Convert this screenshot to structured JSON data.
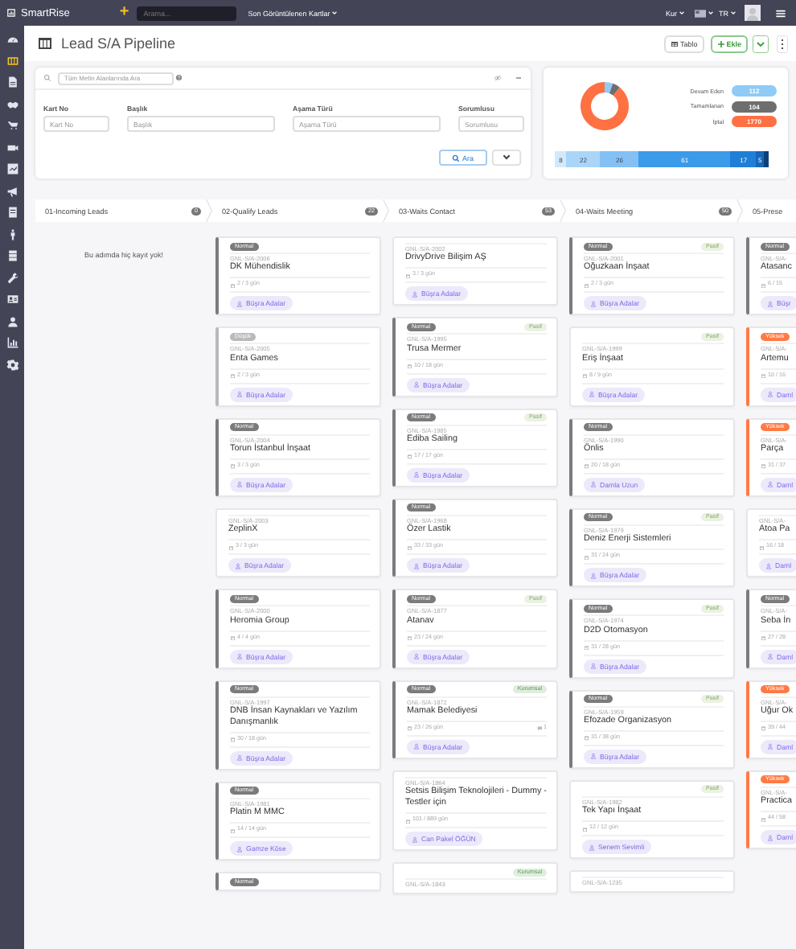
{
  "top_bar": {
    "logo": "SmartRise",
    "add": "+",
    "search": {
      "placeholder": "Arama..."
    },
    "recent": "Son Görüntülenen Kartlar",
    "currency": "Kur",
    "language": "TR"
  },
  "sidebar": {
    "items": [
      {
        "selected": false
      },
      {
        "selected": true
      },
      {
        "selected": false
      },
      {
        "selected": false
      },
      {
        "selected": false
      },
      {
        "selected": false
      },
      {
        "selected": false
      },
      {
        "selected": false
      },
      {
        "selected": false
      },
      {
        "selected": false
      },
      {
        "selected": false
      },
      {
        "selected": false
      },
      {
        "selected": false
      },
      {
        "selected": false
      },
      {
        "selected": false
      },
      {
        "selected": false
      }
    ]
  },
  "page": {
    "title": "Lead S/A Pipeline",
    "buttons": {
      "table": "Tablo",
      "add": "Ekle"
    }
  },
  "filter": {
    "search": {
      "placeholder": "Tüm Metin Alanlarında Ara"
    },
    "fields": [
      {
        "label": "Kart No",
        "placeholder": "Kart No"
      },
      {
        "label": "Başlık",
        "placeholder": "Başlık"
      },
      {
        "label": "Aşama Türü",
        "placeholder": "Aşama Türü"
      },
      {
        "label": "Sorumlusu",
        "placeholder": "Sorumlusu"
      }
    ],
    "search_button": "Ara"
  },
  "summary": {
    "chart_data": {
      "type": "donut",
      "categories": [
        "Devam Eden",
        "Tamamlanan",
        "İptal"
      ],
      "values": [
        5.6,
        5.2,
        89.2
      ]
    },
    "legend": [
      {
        "count": "112",
        "color": "#8ecbf6"
      },
      {
        "count": "104",
        "color": "#6e6e6e"
      },
      {
        "count": "1770",
        "color": "#ff7043"
      }
    ],
    "stage_bar": [
      {
        "label": "8",
        "color": "#d3e9fb"
      },
      {
        "label": "22",
        "color": "#aad5f8"
      },
      {
        "label": "26",
        "color": "#84c0f3"
      },
      {
        "label": "61",
        "color": "#3c9aea"
      },
      {
        "label": "17",
        "color": "#1f7fd6"
      },
      {
        "label": "5",
        "color": "#1766b9"
      },
      {
        "color": "#0d3f7a"
      }
    ]
  },
  "columns": [
    {
      "title": "01-Incoming Leads",
      "count": "0",
      "empty": "Bu adımda hiç kayıt yok!"
    },
    {
      "title": "02-Qualify Leads",
      "count": "22",
      "cards": [
        {
          "priority": {
            "text": "Normal",
            "kind": "normal"
          },
          "code": "GNL-S/A-2006",
          "title": "DK Mühendislik",
          "days": "2 / 3 gün",
          "owner": "Büşra Adalar"
        },
        {
          "priority": {
            "text": "Düşük",
            "kind": "low"
          },
          "code": "GNL-S/A-2005",
          "title": "Enta Games",
          "days": "2 / 3 gün",
          "owner": "Büşra Adalar"
        },
        {
          "priority": {
            "text": "Normal",
            "kind": "normal"
          },
          "code": "GNL-S/A-2004",
          "title": "Torun İstanbul İnşaat",
          "days": "3 / 3 gün",
          "owner": "Büşra Adalar"
        },
        {
          "code": "GNL-S/A-2003",
          "title": "ZeplinX",
          "days": "3 / 3 gün",
          "owner": "Büşra Adalar"
        },
        {
          "priority": {
            "text": "Normal",
            "kind": "normal"
          },
          "code": "GNL-S/A-2000",
          "title": "Heromia Group",
          "days": "4 / 4 gün",
          "owner": "Büşra Adalar"
        },
        {
          "priority": {
            "text": "Normal",
            "kind": "normal"
          },
          "code": "GNL-S/A-1997",
          "title": "DNB İnsan Kaynakları ve Yazılım Danışmanlık",
          "days": "30 / 18 gün",
          "owner": "Büşra Adalar"
        },
        {
          "priority": {
            "text": "Normal",
            "kind": "normal"
          },
          "code": "GNL-S/A-1981",
          "title": "Platin M MMC",
          "days": "14 / 14 gün",
          "owner": "Gamze Köse"
        },
        {
          "priority": {
            "text": "Normal",
            "kind": "normal"
          }
        }
      ]
    },
    {
      "title": "03-Waits Contact",
      "count": "53",
      "cards": [
        {
          "code": "GNL-S/A-2002",
          "title": "DrivyDrive Bilişim AŞ",
          "days": "3 / 3 gün",
          "owner": "Büşra Adalar"
        },
        {
          "priority": {
            "text": "Normal",
            "kind": "normal"
          },
          "tag": {
            "text": "Pasif",
            "kind": "passive"
          },
          "code": "GNL-S/A-1995",
          "title": "Trusa Mermer",
          "days": "10 / 18 gün",
          "owner": "Büşra Adalar"
        },
        {
          "priority": {
            "text": "Normal",
            "kind": "normal"
          },
          "tag": {
            "text": "Pasif",
            "kind": "passive"
          },
          "code": "GNL-S/A-1985",
          "title": "Ediba Sailing",
          "days": "17 / 17 gün",
          "owner": "Büşra Adalar"
        },
        {
          "priority": {
            "text": "Normal",
            "kind": "normal"
          },
          "code": "GNL-S/A-1968",
          "title": "Özer Lastik",
          "days": "33 / 33 gün",
          "owner": "Büşra Adalar"
        },
        {
          "priority": {
            "text": "Normal",
            "kind": "normal"
          },
          "tag": {
            "text": "Pasif",
            "kind": "passive"
          },
          "code": "GNL-S/A-1877",
          "title": "Atanav",
          "days": "23 / 24 gün",
          "owner": "Büşra Adalar"
        },
        {
          "priority": {
            "text": "Normal",
            "kind": "normal"
          },
          "tag": {
            "text": "Kurumsal",
            "kind": "corporate"
          },
          "code": "GNL-S/A-1872",
          "title": "Mamak Belediyesi",
          "days": "23 / 26 gün",
          "comments": "1",
          "owner": "Büşra Adalar"
        },
        {
          "code": "GNL-S/A-1864",
          "title": "Setsis Bilişim Teknolojileri - Dummy - Testler için",
          "days": "101 / 889 gün",
          "owner": "Can Pakel ÖĞÜN"
        },
        {
          "tag": {
            "text": "Kurumsal",
            "kind": "corporate"
          },
          "code": "GNL-S/A-1843"
        }
      ]
    },
    {
      "title": "04-Waits Meeting",
      "count": "50",
      "cards": [
        {
          "priority": {
            "text": "Normal",
            "kind": "normal"
          },
          "tag": {
            "text": "Pasif",
            "kind": "passive"
          },
          "code": "GNL-S/A-2001",
          "title": "Oğuzkaan İnşaat",
          "days": "2 / 3 gün",
          "owner": "Büşra Adalar"
        },
        {
          "tag": {
            "text": "Pasif",
            "kind": "passive"
          },
          "code": "GNL-S/A-1999",
          "title": "Eriş İnşaat",
          "days": "8 / 9 gün",
          "owner": "Büşra Adalar"
        },
        {
          "priority": {
            "text": "Normal",
            "kind": "normal"
          },
          "code": "GNL-S/A-1990",
          "title": "Önlis",
          "days": "20 / 18 gün",
          "owner": "Damla Uzun"
        },
        {
          "priority": {
            "text": "Normal",
            "kind": "normal"
          },
          "tag": {
            "text": "Pasif",
            "kind": "passive"
          },
          "code": "GNL-S/A-1979",
          "title": "Deniz Enerji Sistemleri",
          "days": "31 / 24 gün",
          "owner": "Büşra Adalar"
        },
        {
          "priority": {
            "text": "Normal",
            "kind": "normal"
          },
          "tag": {
            "text": "Pasif",
            "kind": "passive"
          },
          "code": "GNL-S/A-1974",
          "title": "D2D Otomasyon",
          "days": "31 / 28 gün",
          "owner": "Büşra Adalar"
        },
        {
          "priority": {
            "text": "Normal",
            "kind": "normal"
          },
          "tag": {
            "text": "Pasif",
            "kind": "passive"
          },
          "code": "GNL-S/A-1959",
          "title": "Efozade Organizasyon",
          "days": "31 / 38 gün",
          "owner": "Büşra Adalar"
        },
        {
          "tag": {
            "text": "Pasif",
            "kind": "passive"
          },
          "code": "GNL-S/A-1982",
          "title": "Tek Yapı İnşaat",
          "days": "12 / 12 gün",
          "owner": "Senem Sevimli"
        },
        {
          "code": "GNL-S/A-1235"
        }
      ]
    },
    {
      "title": "05-Prese",
      "cards": [
        {
          "priority": {
            "text": "Normal",
            "kind": "normal"
          },
          "code": "GNL-S/A-",
          "title": "Atasanc",
          "days": "6 / 15",
          "owner": "Büşr"
        },
        {
          "priority": {
            "text": "Yüksek",
            "kind": "high"
          },
          "code": "GNL-S/A-",
          "title": "Artemu",
          "days": "10 / 16",
          "owner": "Daml"
        },
        {
          "priority": {
            "text": "Yüksek",
            "kind": "high"
          },
          "code": "GNL-S/A-",
          "title": "Parça",
          "days": "31 / 37",
          "owner": "Daml"
        },
        {
          "code": "GNL-S/A-",
          "title": "Atoa Pa",
          "days": "16 / 18",
          "owner": "Daml"
        },
        {
          "priority": {
            "text": "Normal",
            "kind": "normal"
          },
          "code": "GNL-S/A-",
          "title": "Seba İn",
          "days": "27 / 28",
          "owner": "Daml"
        },
        {
          "priority": {
            "text": "Yüksek",
            "kind": "high"
          },
          "code": "GNL-S/A-",
          "title": "Uğur Ok",
          "days": "39 / 44",
          "owner": "Daml"
        },
        {
          "priority": {
            "text": "Yüksek",
            "kind": "high"
          },
          "code": "GNL-S/A-",
          "title": "Practica",
          "days": "44 / 58",
          "owner": "Daml"
        }
      ]
    }
  ]
}
